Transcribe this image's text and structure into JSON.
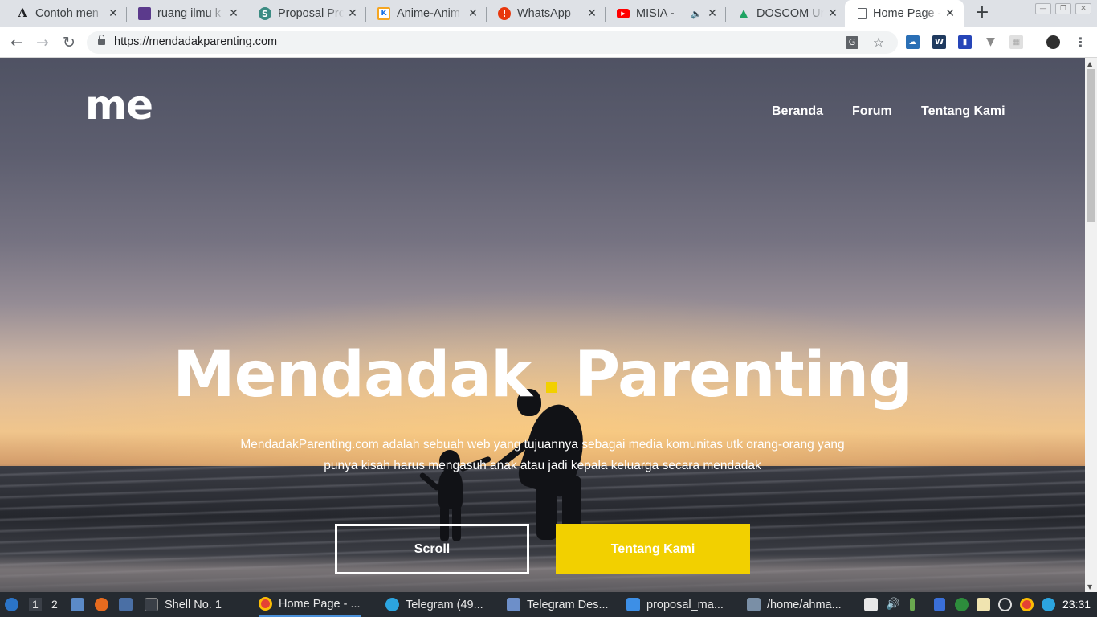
{
  "browser": {
    "tabs": [
      {
        "title": "Contoh men",
        "favicon": "letter-a-icon",
        "color": "#ffffff",
        "glyph": "A"
      },
      {
        "title": "ruang ilmu k",
        "favicon": "ruang-ilmu-icon",
        "color": "#5b3a8c",
        "glyph": ""
      },
      {
        "title": "Proposal Pro",
        "favicon": "proposal-icon",
        "color": "#3c8c83",
        "glyph": "S"
      },
      {
        "title": "Anime-Anim",
        "favicon": "kaskus-icon",
        "color": "#f5a623",
        "glyph": "K"
      },
      {
        "title": "WhatsApp",
        "favicon": "alert-icon",
        "color": "#e8380d",
        "glyph": "!"
      },
      {
        "title": "MISIA - ",
        "favicon": "youtube-icon",
        "color": "#ff0000",
        "glyph": "▶"
      },
      {
        "title": "DOSCOM Un",
        "favicon": "google-drive-icon",
        "color": "#1fa463",
        "glyph": "▲"
      },
      {
        "title": "Home Page - ",
        "favicon": "page-icon",
        "color": "#ffffff",
        "glyph": ""
      }
    ],
    "close_glyph": "✕",
    "new_tab_glyph": "+",
    "url": "https://mendadakparenting.com",
    "nav": {
      "back": "←",
      "forward": "→",
      "reload": "↻"
    }
  },
  "page": {
    "logo": "me",
    "nav": [
      "Beranda",
      "Forum",
      "Tentang Kami"
    ],
    "title_left": "Mendadak",
    "title_right": "Parenting",
    "description": "MendadakParenting.com adalah sebuah web yang tujuannya sebagai media komunitas utk orang-orang yang punya kisah harus mengasuh anak atau jadi kepala keluarga secara mendadak",
    "btn_scroll": "Scroll",
    "btn_about": "Tentang Kami",
    "accent": "#f2d000"
  },
  "taskbar": {
    "workspaces": [
      "1",
      "2"
    ],
    "tasks": [
      {
        "label": "Shell No. 1",
        "icon": "terminal-icon",
        "color": "#3a3f47"
      },
      {
        "label": "Home Page - ...",
        "icon": "chrome-icon",
        "color": "#e44134"
      },
      {
        "label": "Telegram (49...",
        "icon": "telegram-icon",
        "color": "#2ca5e0"
      },
      {
        "label": "Telegram Des...",
        "icon": "folder-icon",
        "color": "#6d8fc9"
      },
      {
        "label": "proposal_ma...",
        "icon": "wps-writer-icon",
        "color": "#3d8fe6"
      },
      {
        "label": "/home/ahma...",
        "icon": "image-viewer-icon",
        "color": "#7a8fa6"
      }
    ],
    "clock": "23:31"
  }
}
